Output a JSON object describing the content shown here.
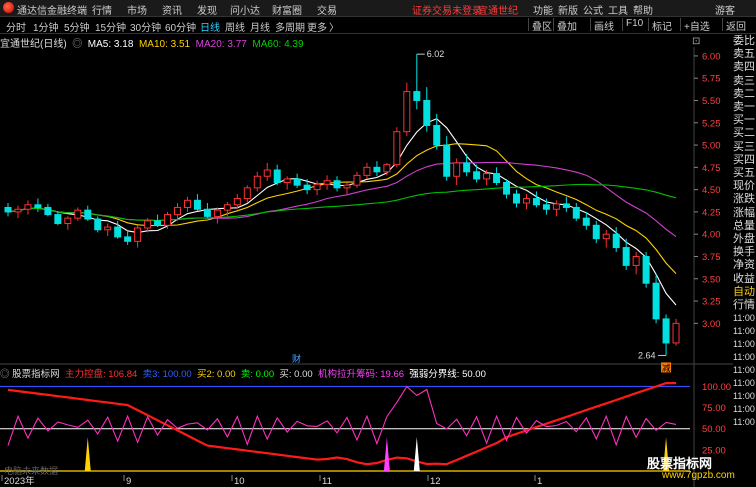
{
  "menubar": {
    "app_title": "通达信金融终端",
    "items": [
      "行情",
      "市场",
      "资讯",
      "发现",
      "问小达",
      "财富圈",
      "交易"
    ],
    "notice": "证券交易未登录",
    "stock": "宜通世纪",
    "right_items": [
      "功能",
      "新版",
      "公式",
      "工具",
      "帮助",
      "游客"
    ]
  },
  "toolbar": {
    "periods": [
      "分时",
      "1分钟",
      "5分钟",
      "15分钟",
      "30分钟",
      "60分钟",
      "日线",
      "周线",
      "月线",
      "多周期",
      "更多"
    ],
    "active_period": "日线",
    "more_arrow": "〉",
    "right_buttons": [
      "叠区",
      "叠加",
      "画线",
      "F10",
      "标记",
      "+自选",
      "返回"
    ]
  },
  "legend": {
    "title": "宜通世纪(日线)",
    "ma5": "MA5: 3.18",
    "ma10": "MA10: 3.51",
    "ma20": "MA20: 3.77",
    "ma60": "MA60: 4.39",
    "colors": {
      "ma5": "#ffffff",
      "ma10": "#ffd200",
      "ma20": "#d040d0",
      "ma60": "#00c000"
    }
  },
  "price_axis": {
    "ticks": [
      "6.00",
      "5.75",
      "5.50",
      "5.25",
      "5.00",
      "4.75",
      "4.50",
      "4.25",
      "4.00",
      "3.75",
      "3.50",
      "3.25",
      "3.00"
    ],
    "high_label": "6.02",
    "low_label": "2.64"
  },
  "right_panel": {
    "items": [
      "委比",
      "卖五",
      "卖四",
      "卖三",
      "卖二",
      "卖一",
      "买一",
      "买二",
      "买三",
      "买四",
      "买五",
      "现价",
      "涨跌",
      "涨幅",
      "总量",
      "外盘",
      "换手",
      "净资",
      "收益",
      "自动",
      "行情"
    ],
    "times": [
      "11:00",
      "11:00",
      "11:00",
      "11:00",
      "11:00",
      "11:00",
      "11:00",
      "11:00",
      "11:00"
    ]
  },
  "indicator": {
    "title": "股票指标网",
    "main_force": "主力控盘: 106.84",
    "sell": "卖3: 100.00",
    "buy2": "买2: 0.00",
    "sell2": "卖: 0.00",
    "buy": "买: 0.00",
    "chip": "机构拉升筹码: 19.66",
    "strength": "强弱分界线: 50.00",
    "axis": [
      "100.00",
      "75.00",
      "50.00",
      "25.00"
    ],
    "bottom_label": "电脑未来数据"
  },
  "chart_markers": {
    "cai": "财",
    "jian": "减"
  },
  "date_axis": [
    "2023年",
    "9",
    "10",
    "11",
    "12",
    "1"
  ],
  "watermark": {
    "line1": "股票指标网",
    "line2": "www.7gpzb.com"
  },
  "chart_data": {
    "type": "candlestick",
    "title": "宜通世纪(日线)",
    "ylim": [
      2.6,
      6.1
    ],
    "last": {
      "ma5": 3.18,
      "ma10": 3.51,
      "ma20": 3.77,
      "ma60": 4.39
    },
    "high": 6.02,
    "low": 2.64,
    "ohlc": [
      [
        4.3,
        4.35,
        4.2,
        4.25
      ],
      [
        4.25,
        4.32,
        4.18,
        4.28
      ],
      [
        4.28,
        4.38,
        4.22,
        4.33
      ],
      [
        4.33,
        4.4,
        4.25,
        4.3
      ],
      [
        4.3,
        4.34,
        4.2,
        4.22
      ],
      [
        4.22,
        4.26,
        4.1,
        4.12
      ],
      [
        4.12,
        4.2,
        4.05,
        4.18
      ],
      [
        4.18,
        4.3,
        4.15,
        4.27
      ],
      [
        4.27,
        4.32,
        4.15,
        4.17
      ],
      [
        4.17,
        4.2,
        4.02,
        4.05
      ],
      [
        4.05,
        4.12,
        3.98,
        4.08
      ],
      [
        4.08,
        4.15,
        3.95,
        3.97
      ],
      [
        3.97,
        4.05,
        3.88,
        3.92
      ],
      [
        3.92,
        4.1,
        3.85,
        4.07
      ],
      [
        4.07,
        4.18,
        4.02,
        4.15
      ],
      [
        4.15,
        4.22,
        4.08,
        4.1
      ],
      [
        4.1,
        4.25,
        4.06,
        4.22
      ],
      [
        4.22,
        4.35,
        4.15,
        4.3
      ],
      [
        4.3,
        4.42,
        4.25,
        4.38
      ],
      [
        4.38,
        4.45,
        4.26,
        4.28
      ],
      [
        4.28,
        4.35,
        4.18,
        4.2
      ],
      [
        4.2,
        4.3,
        4.12,
        4.27
      ],
      [
        4.27,
        4.36,
        4.2,
        4.33
      ],
      [
        4.33,
        4.45,
        4.28,
        4.4
      ],
      [
        4.4,
        4.55,
        4.35,
        4.52
      ],
      [
        4.52,
        4.7,
        4.48,
        4.65
      ],
      [
        4.65,
        4.8,
        4.6,
        4.72
      ],
      [
        4.72,
        4.78,
        4.55,
        4.58
      ],
      [
        4.58,
        4.65,
        4.5,
        4.62
      ],
      [
        4.62,
        4.68,
        4.52,
        4.55
      ],
      [
        4.55,
        4.62,
        4.45,
        4.5
      ],
      [
        4.5,
        4.6,
        4.44,
        4.56
      ],
      [
        4.56,
        4.66,
        4.5,
        4.6
      ],
      [
        4.6,
        4.65,
        4.48,
        4.52
      ],
      [
        4.52,
        4.58,
        4.45,
        4.55
      ],
      [
        4.55,
        4.7,
        4.52,
        4.66
      ],
      [
        4.66,
        4.8,
        4.62,
        4.75
      ],
      [
        4.75,
        4.82,
        4.65,
        4.7
      ],
      [
        4.7,
        4.8,
        4.66,
        4.78
      ],
      [
        4.78,
        5.2,
        4.75,
        5.15
      ],
      [
        5.15,
        5.7,
        5.1,
        5.6
      ],
      [
        5.6,
        6.02,
        5.4,
        5.5
      ],
      [
        5.5,
        5.65,
        5.15,
        5.22
      ],
      [
        5.22,
        5.35,
        4.95,
        5.0
      ],
      [
        5.0,
        5.1,
        4.6,
        4.65
      ],
      [
        4.65,
        4.85,
        4.55,
        4.8
      ],
      [
        4.8,
        4.9,
        4.65,
        4.7
      ],
      [
        4.7,
        4.78,
        4.58,
        4.62
      ],
      [
        4.62,
        4.72,
        4.55,
        4.68
      ],
      [
        4.68,
        4.75,
        4.55,
        4.58
      ],
      [
        4.58,
        4.62,
        4.4,
        4.45
      ],
      [
        4.45,
        4.5,
        4.3,
        4.35
      ],
      [
        4.35,
        4.45,
        4.28,
        4.4
      ],
      [
        4.4,
        4.48,
        4.3,
        4.33
      ],
      [
        4.33,
        4.4,
        4.22,
        4.28
      ],
      [
        4.28,
        4.38,
        4.2,
        4.34
      ],
      [
        4.34,
        4.42,
        4.25,
        4.3
      ],
      [
        4.3,
        4.35,
        4.15,
        4.18
      ],
      [
        4.18,
        4.25,
        4.05,
        4.1
      ],
      [
        4.1,
        4.15,
        3.9,
        3.95
      ],
      [
        3.95,
        4.05,
        3.85,
        4.0
      ],
      [
        4.0,
        4.08,
        3.8,
        3.85
      ],
      [
        3.85,
        3.95,
        3.6,
        3.65
      ],
      [
        3.65,
        3.8,
        3.55,
        3.75
      ],
      [
        3.75,
        3.8,
        3.4,
        3.45
      ],
      [
        3.45,
        3.55,
        3.0,
        3.05
      ],
      [
        3.05,
        3.1,
        2.64,
        2.78
      ],
      [
        2.78,
        3.05,
        2.75,
        3.0
      ]
    ]
  }
}
